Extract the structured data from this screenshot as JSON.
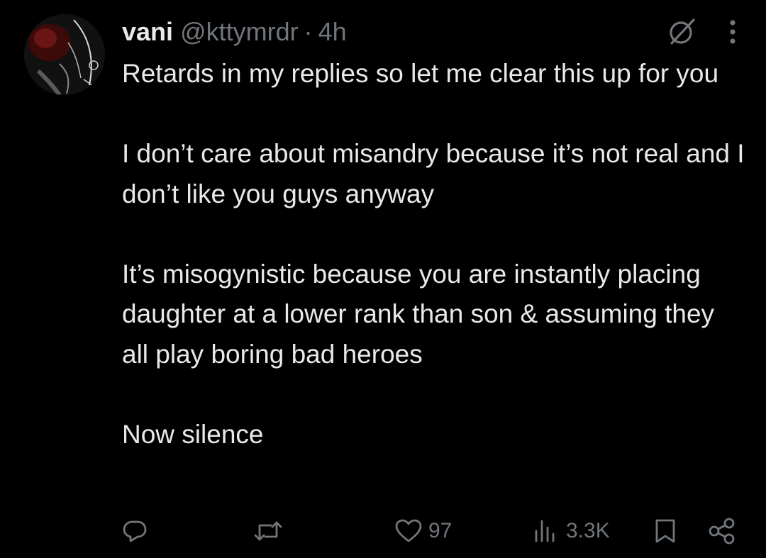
{
  "tweet": {
    "display_name": "vani",
    "handle": "@kttymrdr",
    "separator": "·",
    "time": "4h",
    "body": [
      "Retards in my replies so let me clear this up for you",
      "I don’t care about misandry because it’s not real and I don’t like you guys anyway",
      "It’s misogynistic because you are instantly placing daughter at a lower rank than son & assuming they all play boring bad heroes",
      "Now silence"
    ]
  },
  "header_icons": {
    "grok_icon": "slashed-circle-icon",
    "more_icon": "more-vertical-icon"
  },
  "actions": {
    "reply": {
      "icon": "reply-icon",
      "count": ""
    },
    "repost": {
      "icon": "repost-icon",
      "count": ""
    },
    "like": {
      "icon": "heart-icon",
      "count": "97"
    },
    "views": {
      "icon": "views-icon",
      "count": "3.3K"
    },
    "bookmark": {
      "icon": "bookmark-icon"
    },
    "share": {
      "icon": "share-icon"
    }
  },
  "colors": {
    "background": "#000000",
    "text": "#e7e9ea",
    "secondary": "#71767b"
  }
}
